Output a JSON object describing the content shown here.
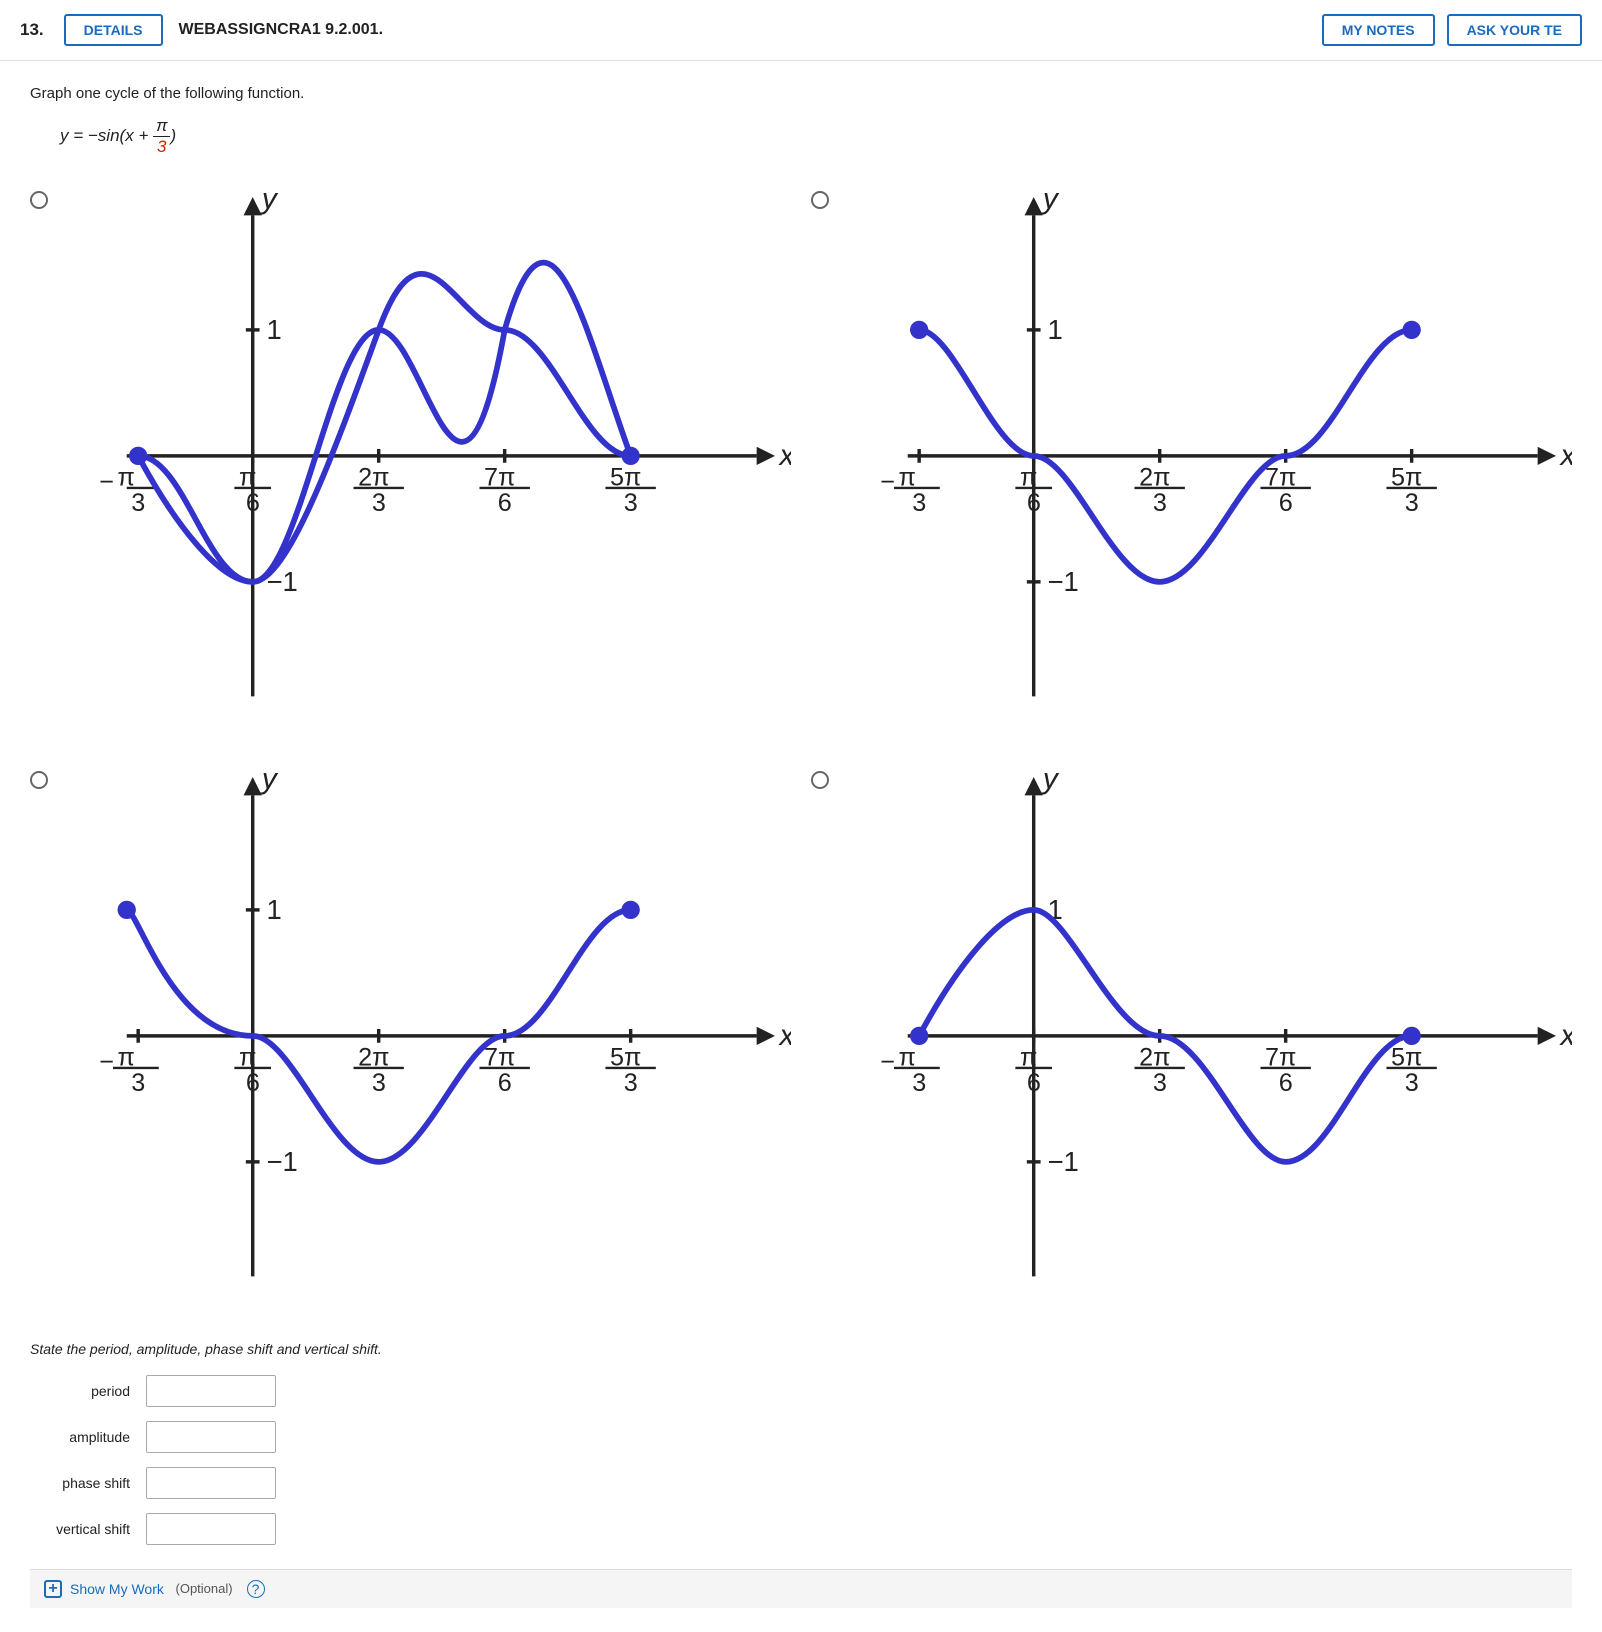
{
  "header": {
    "question_number": "13.",
    "details_label": "DETAILS",
    "problem_id": "WEBASSIGNCRA1 9.2.001.",
    "my_notes_label": "MY NOTES",
    "ask_label": "ASK YOUR TE"
  },
  "content": {
    "instruction": "Graph one cycle of the following function.",
    "formula": "y = −sin(x + π/3)",
    "formula_parts": {
      "prefix": "y = −sin",
      "open_paren": "(",
      "x": "x + ",
      "numerator": "π",
      "denominator": "3",
      "close_paren": ")"
    }
  },
  "graphs": [
    {
      "id": "graph-1",
      "selected": false,
      "description": "sine curve starting at bottom-left, peak in upper middle area"
    },
    {
      "id": "graph-2",
      "selected": false,
      "description": "sine curve starting at top, descends then rises"
    },
    {
      "id": "graph-3",
      "selected": false,
      "description": "sine curve peaks then dips"
    },
    {
      "id": "graph-4",
      "selected": false,
      "description": "sine curve dips then peaks"
    }
  ],
  "state_section": {
    "instruction": "State the period, amplitude, phase shift and vertical shift.",
    "fields": [
      {
        "id": "period",
        "label": "period",
        "value": ""
      },
      {
        "id": "amplitude",
        "label": "amplitude",
        "value": ""
      },
      {
        "id": "phase_shift",
        "label": "phase shift",
        "value": ""
      },
      {
        "id": "vertical_shift",
        "label": "vertical shift",
        "value": ""
      }
    ]
  },
  "show_work": {
    "label": "Show My Work",
    "optional": "(Optional)"
  },
  "colors": {
    "blue": "#3333cc",
    "axis": "#222",
    "label": "#222",
    "red": "#cc2200"
  },
  "axis_labels": {
    "y": "y",
    "x": "x",
    "x_ticks": [
      "-π/3",
      "π/6",
      "2π/3",
      "7π/6",
      "5π/3"
    ],
    "y_ticks": [
      "1",
      "-1"
    ]
  }
}
